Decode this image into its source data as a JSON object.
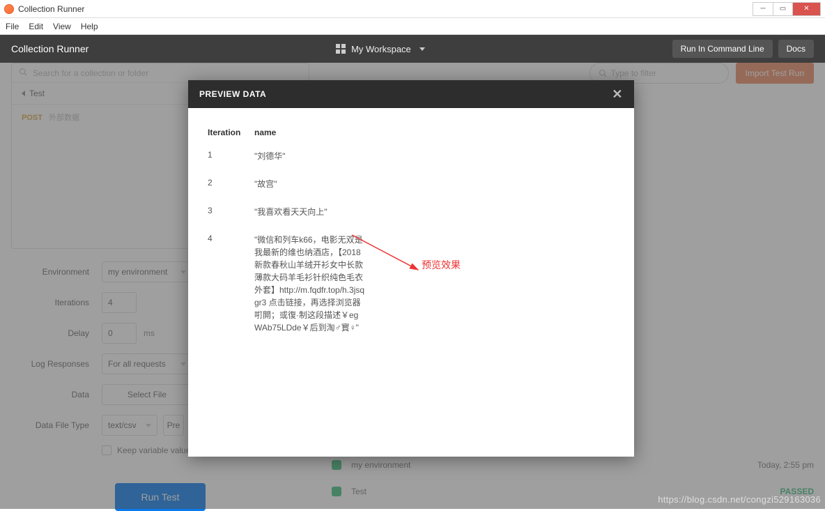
{
  "window": {
    "title": "Collection Runner"
  },
  "menubar": [
    "File",
    "Edit",
    "View",
    "Help"
  ],
  "toolbar": {
    "title": "Collection Runner",
    "workspace_label": "My Workspace",
    "run_cli": "Run In Command Line",
    "docs": "Docs"
  },
  "left": {
    "search_placeholder": "Search for a collection or folder",
    "back_item": "Test",
    "request": {
      "method": "POST",
      "name": "外部数据"
    },
    "form": {
      "environment_label": "Environment",
      "environment_value": "my environment",
      "iterations_label": "Iterations",
      "iterations_value": "4",
      "delay_label": "Delay",
      "delay_value": "0",
      "delay_unit": "ms",
      "log_label": "Log Responses",
      "log_value": "For all requests",
      "data_label": "Data",
      "data_button": "Select File",
      "filetype_label": "Data File Type",
      "filetype_value": "text/csv",
      "preview_button": "Pre",
      "keep_var_label": "Keep variable values"
    },
    "run_button": "Run Test"
  },
  "right": {
    "filter_placeholder": "Type to filter",
    "import_button": "Import Test Run",
    "runs": [
      {
        "label": "my environment",
        "time": "Today, 2:55 pm",
        "status": ""
      },
      {
        "label": "Test",
        "time": "",
        "status": "PASSED"
      }
    ]
  },
  "modal": {
    "title": "PREVIEW DATA",
    "columns": [
      "Iteration",
      "name"
    ],
    "rows": [
      {
        "iteration": "1",
        "name": "\"刘德华\""
      },
      {
        "iteration": "2",
        "name": "\"故宫\""
      },
      {
        "iteration": "3",
        "name": "\"我喜欢看天天向上\""
      },
      {
        "iteration": "4",
        "name": "\"微信和列车k66，电影无双是我最新的维也纳酒店，【2018新款春秋山羊绒开衫女中长款薄款大码羊毛衫针织纯色毛衣外套】http://m.fqdfr.top/h.3jsqgr3 点击链接，再选择浏览器咑閞；或復·制这段描述￥egWAb75LDde￥后到淘♂寳♀\""
      }
    ]
  },
  "annotation": {
    "label": "预览效果"
  },
  "watermark": "https://blog.csdn.net/congzi529163036"
}
